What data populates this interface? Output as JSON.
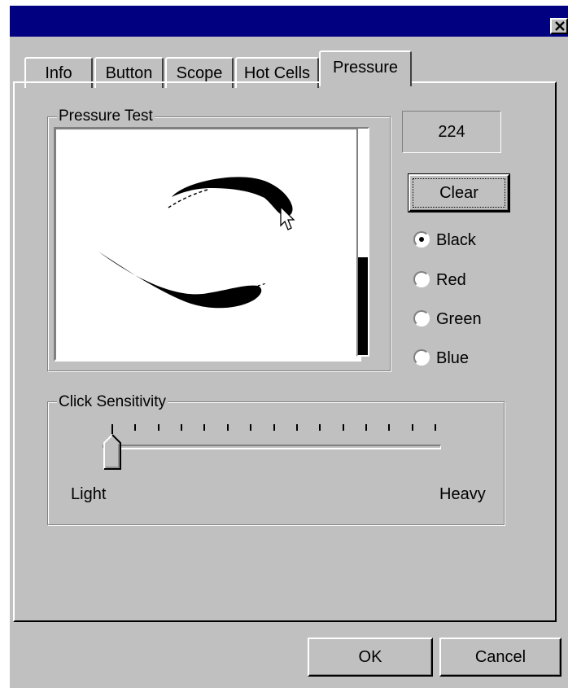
{
  "tabs": [
    {
      "label": "Info",
      "active": false
    },
    {
      "label": "Button",
      "active": false
    },
    {
      "label": "Scope",
      "active": false
    },
    {
      "label": "Hot Cells",
      "active": false
    },
    {
      "label": "Pressure",
      "active": true
    }
  ],
  "pressure_test": {
    "group_label": "Pressure Test",
    "pressure_value": "224",
    "pressure_level_fraction": 0.43,
    "clear_label": "Clear",
    "colors": [
      {
        "label": "Black",
        "selected": true,
        "hex": "#000000"
      },
      {
        "label": "Red",
        "selected": false,
        "hex": "#ff0000"
      },
      {
        "label": "Green",
        "selected": false,
        "hex": "#008000"
      },
      {
        "label": "Blue",
        "selected": false,
        "hex": "#0000ff"
      }
    ]
  },
  "click_sensitivity": {
    "group_label": "Click Sensitivity",
    "min_label": "Light",
    "max_label": "Heavy",
    "tick_count": 15,
    "value_position": 0
  },
  "footer": {
    "ok_label": "OK",
    "cancel_label": "Cancel"
  },
  "theme": {
    "face": "#c0c0c0",
    "titlebar": "#000080"
  }
}
